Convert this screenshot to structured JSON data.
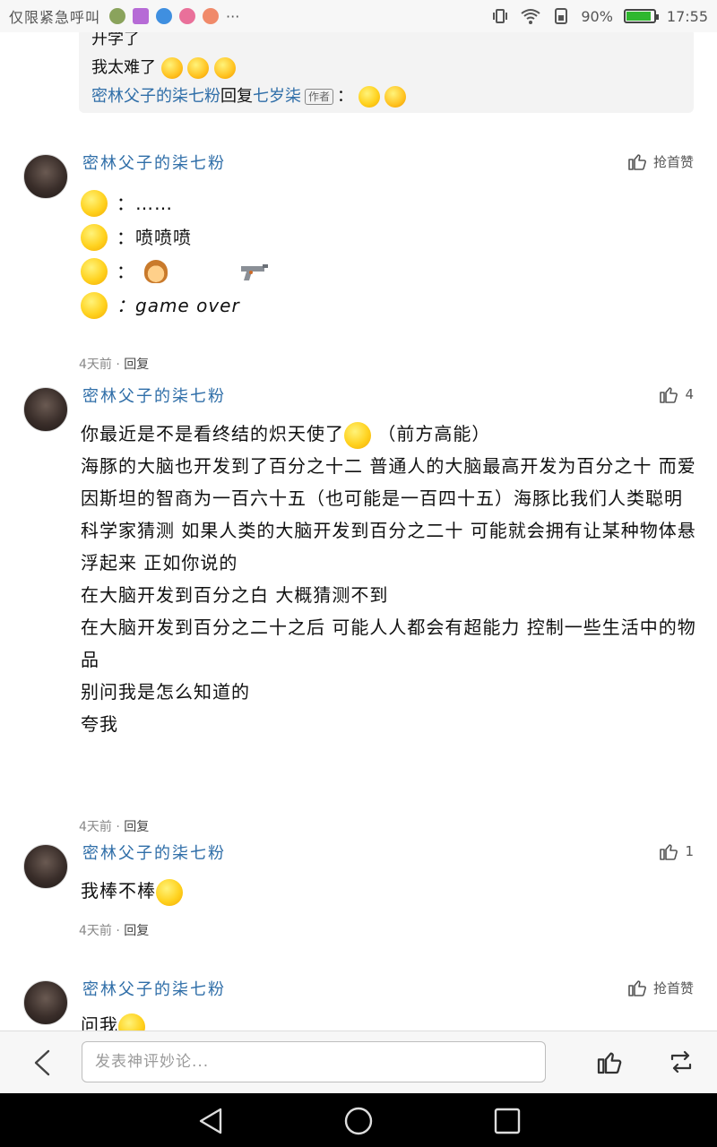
{
  "status_bar": {
    "carrier_text": "仅限紧急呼叫",
    "more": "···",
    "battery_text": "90%",
    "battery_level": 0.9,
    "time": "17:55"
  },
  "quote": {
    "cut_line": "开学了",
    "line2": "我太难了",
    "reply_from": "密林父子的柒七粉",
    "reply_word": "回复",
    "reply_to": "七岁柒",
    "author_tag": "作者",
    "colon": "："
  },
  "comments": [
    {
      "username": "密林父子的柒七粉",
      "like_text": "抢首赞",
      "lines": [
        "：……",
        "：喷喷喷",
        "：",
        "：game over"
      ],
      "time": "4天前",
      "dot": "·",
      "reply": "回复"
    },
    {
      "username": "密林父子的柒七粉",
      "like_count": "4",
      "paragraphs": [
        "你最近是不是看终结的炽天使了",
        "（前方高能）",
        "海豚的大脑也开发到了百分之十二 普通人的大脑最高开发为百分之十 而爱因斯坦的智商为一百六十五（也可能是一百四十五）海豚比我们人类聪明 科学家猜测 如果人类的大脑开发到百分之二十 可能就会拥有让某种物体悬浮起来 正如你说的",
        "在大脑开发到百分之白 大概猜测不到",
        "在大脑开发到百分之二十之后 可能人人都会有超能力 控制一些生活中的物品",
        "别问我是怎么知道的",
        "夸我"
      ],
      "time": "4天前",
      "dot": "·",
      "reply": "回复"
    },
    {
      "username": "密林父子的柒七粉",
      "like_count": "1",
      "text": "我棒不棒",
      "time": "4天前",
      "dot": "·",
      "reply": "回复"
    },
    {
      "username": "密林父子的柒七粉",
      "like_text": "抢首赞",
      "text": "问我"
    }
  ],
  "bottom_bar": {
    "placeholder": "发表神评妙论..."
  }
}
